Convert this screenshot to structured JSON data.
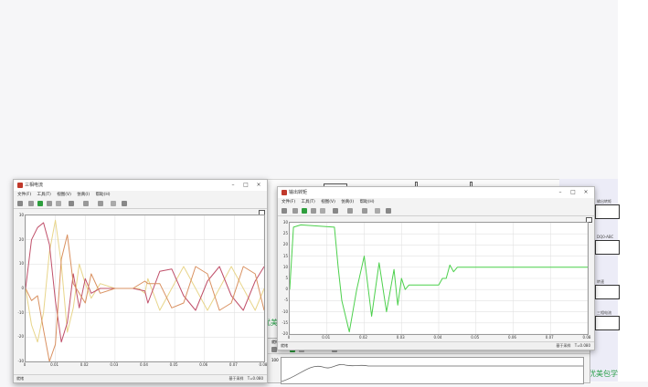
{
  "window_left": {
    "title": "三相电流",
    "menu": [
      "文件(F)",
      "工具(T)",
      "视图(V)",
      "仿真(I)",
      "帮助(H)"
    ],
    "status_left": "就绪",
    "status_right_1": "基于采样",
    "status_right_2": "T=0.080",
    "y_ticks": [
      "30",
      "20",
      "10",
      "0",
      "-10",
      "-20",
      "-30"
    ],
    "x_ticks": [
      "0",
      "0.01",
      "0.02",
      "0.03",
      "0.04",
      "0.05",
      "0.06",
      "0.07",
      "0.08"
    ]
  },
  "window_right": {
    "title": "输出转矩",
    "menu": [
      "文件(F)",
      "工具(T)",
      "视图(V)",
      "仿真(I)",
      "帮助(H)"
    ],
    "status_left": "就绪",
    "status_right_1": "基于采样",
    "status_right_2": "T=0.080",
    "y_ticks": [
      "30",
      "25",
      "20",
      "15",
      "10",
      "5",
      "0",
      "-5",
      "-10",
      "-15",
      "-20"
    ],
    "x_ticks": [
      "0",
      "0.01",
      "0.02",
      "0.03",
      "0.04",
      "0.05",
      "0.06",
      "0.07",
      "0.08"
    ]
  },
  "window_third": {
    "status_left": "就绪",
    "y_tick_top": "100"
  },
  "simulink": {
    "labels_right": [
      "输出转矩",
      "DQ0-ABC",
      "转速",
      "三相电流"
    ],
    "green_label_1": "优美包",
    "green_label_2": "优美包学"
  },
  "colors": {
    "phase_a": "#e8d58a",
    "phase_b": "#c0506a",
    "phase_c": "#d99060",
    "torque": "#4cd04c"
  },
  "chart_data": [
    {
      "type": "line",
      "title": "三相电流",
      "x_range": [
        0,
        0.08
      ],
      "y_range": [
        -30,
        30
      ],
      "series": [
        {
          "values": [
            [
              0,
              0
            ],
            [
              0.002,
              -15
            ],
            [
              0.004,
              -22
            ],
            [
              0.006,
              -10
            ],
            [
              0.008,
              15
            ],
            [
              0.01,
              28
            ],
            [
              0.012,
              10
            ],
            [
              0.014,
              -18
            ],
            [
              0.016,
              -8
            ],
            [
              0.018,
              10
            ],
            [
              0.02,
              2
            ],
            [
              0.022,
              -4
            ],
            [
              0.025,
              2
            ],
            [
              0.03,
              0
            ],
            [
              0.033,
              0
            ],
            [
              0.036,
              0
            ],
            [
              0.038,
              0
            ],
            [
              0.04,
              -2
            ],
            [
              0.041,
              4
            ],
            [
              0.045,
              -9
            ],
            [
              0.049,
              0
            ],
            [
              0.053,
              9
            ],
            [
              0.057,
              0
            ],
            [
              0.061,
              -9
            ],
            [
              0.065,
              0
            ],
            [
              0.069,
              9
            ],
            [
              0.073,
              0
            ],
            [
              0.077,
              -9
            ],
            [
              0.08,
              0
            ]
          ]
        },
        {
          "values": [
            [
              0,
              0
            ],
            [
              0.002,
              20
            ],
            [
              0.004,
              25
            ],
            [
              0.006,
              27
            ],
            [
              0.008,
              18
            ],
            [
              0.01,
              -5
            ],
            [
              0.012,
              -22
            ],
            [
              0.014,
              -14
            ],
            [
              0.016,
              6
            ],
            [
              0.018,
              -8
            ],
            [
              0.02,
              4
            ],
            [
              0.022,
              -2
            ],
            [
              0.025,
              0
            ],
            [
              0.03,
              0
            ],
            [
              0.036,
              0
            ],
            [
              0.04,
              -1
            ],
            [
              0.041,
              -6
            ],
            [
              0.045,
              7
            ],
            [
              0.049,
              8
            ],
            [
              0.053,
              -3
            ],
            [
              0.057,
              -9
            ],
            [
              0.061,
              3
            ],
            [
              0.065,
              9
            ],
            [
              0.069,
              -3
            ],
            [
              0.073,
              -9
            ],
            [
              0.077,
              3
            ],
            [
              0.08,
              9
            ]
          ]
        },
        {
          "values": [
            [
              0,
              0
            ],
            [
              0.002,
              -5
            ],
            [
              0.004,
              -3
            ],
            [
              0.006,
              -17
            ],
            [
              0.008,
              -30
            ],
            [
              0.01,
              -23
            ],
            [
              0.012,
              12
            ],
            [
              0.014,
              22
            ],
            [
              0.016,
              2
            ],
            [
              0.018,
              -2
            ],
            [
              0.02,
              -6
            ],
            [
              0.022,
              6
            ],
            [
              0.025,
              -2
            ],
            [
              0.03,
              0
            ],
            [
              0.036,
              0
            ],
            [
              0.04,
              3
            ],
            [
              0.041,
              2
            ],
            [
              0.045,
              2
            ],
            [
              0.049,
              -8
            ],
            [
              0.053,
              -6
            ],
            [
              0.057,
              9
            ],
            [
              0.061,
              6
            ],
            [
              0.065,
              -9
            ],
            [
              0.069,
              -6
            ],
            [
              0.073,
              9
            ],
            [
              0.077,
              6
            ],
            [
              0.08,
              -9
            ]
          ]
        }
      ]
    },
    {
      "type": "line",
      "title": "输出转矩",
      "x_range": [
        0,
        0.08
      ],
      "y_range": [
        -20,
        30
      ],
      "series": [
        {
          "values": [
            [
              0,
              0
            ],
            [
              0.001,
              28
            ],
            [
              0.003,
              29
            ],
            [
              0.012,
              28
            ],
            [
              0.013,
              10
            ],
            [
              0.014,
              -5
            ],
            [
              0.016,
              -19
            ],
            [
              0.018,
              0
            ],
            [
              0.02,
              15
            ],
            [
              0.022,
              -12
            ],
            [
              0.024,
              12
            ],
            [
              0.026,
              -10
            ],
            [
              0.028,
              9
            ],
            [
              0.029,
              -7
            ],
            [
              0.03,
              5
            ],
            [
              0.031,
              0
            ],
            [
              0.032,
              2
            ],
            [
              0.04,
              2
            ],
            [
              0.041,
              5
            ],
            [
              0.042,
              5
            ],
            [
              0.043,
              11
            ],
            [
              0.044,
              8
            ],
            [
              0.045,
              10
            ],
            [
              0.08,
              10
            ]
          ]
        }
      ]
    }
  ]
}
